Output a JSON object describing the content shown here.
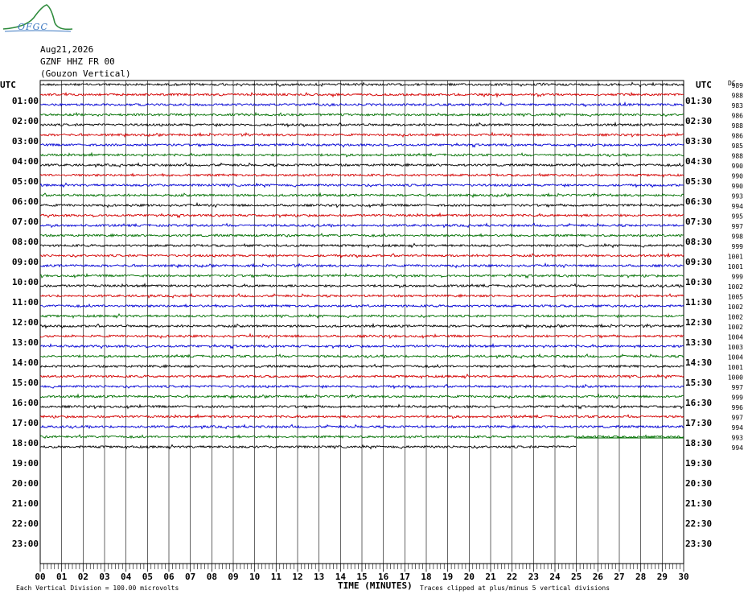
{
  "logo": {
    "text": "OFGC",
    "name": "ofgc-logo"
  },
  "header": {
    "date": "Aug21,2026",
    "station": "GZNF HHZ FR 00",
    "location": "(Gouzon Vertical)"
  },
  "labels": {
    "utc_left": "UTC",
    "utc_right": "UTC",
    "dc": "DC",
    "x_axis_title": "TIME (MINUTES)",
    "scale_note": "Each Vertical Division =  100.00 microvolts",
    "clip_note": "Traces clipped at plus/minus 5 vertical divisions"
  },
  "colors": {
    "trace_cycle": [
      "#000000",
      "#d40000",
      "#0000d4",
      "#007000"
    ],
    "grid": "#000000",
    "logo": "#3a77c0",
    "logo_swoosh": "#2e8b3c"
  },
  "chart_data": {
    "type": "helicorder",
    "x_range_minutes": [
      0,
      30
    ],
    "x_ticks": [
      "00",
      "01",
      "02",
      "03",
      "04",
      "05",
      "06",
      "07",
      "08",
      "09",
      "10",
      "11",
      "12",
      "13",
      "14",
      "15",
      "16",
      "17",
      "18",
      "19",
      "20",
      "21",
      "22",
      "23",
      "24",
      "25",
      "26",
      "27",
      "28",
      "29",
      "30"
    ],
    "left_hour_labels": [
      "",
      "01:00",
      "02:00",
      "03:00",
      "04:00",
      "05:00",
      "06:00",
      "07:00",
      "08:00",
      "09:00",
      "10:00",
      "11:00",
      "12:00",
      "13:00",
      "14:00",
      "15:00",
      "16:00",
      "17:00",
      "18:00",
      "19:00",
      "20:00",
      "21:00",
      "22:00",
      "23:00"
    ],
    "right_hour_labels": [
      "",
      "01:30",
      "02:30",
      "03:30",
      "04:30",
      "05:30",
      "06:30",
      "07:30",
      "08:30",
      "09:30",
      "10:30",
      "11:30",
      "12:30",
      "13:30",
      "14:30",
      "15:30",
      "16:30",
      "17:30",
      "18:30",
      "19:30",
      "20:30",
      "21:30",
      "22:30",
      "23:30"
    ],
    "trace_count": 37,
    "last_trace_end_minute": 25.0,
    "dc_offsets": [
      989,
      988,
      983,
      986,
      988,
      986,
      985,
      988,
      990,
      990,
      990,
      993,
      994,
      995,
      997,
      998,
      999,
      1001,
      1001,
      999,
      1002,
      1005,
      1002,
      1002,
      1002,
      1004,
      1003,
      1004,
      1001,
      1000,
      997,
      999,
      996,
      997,
      994,
      993,
      994
    ]
  }
}
